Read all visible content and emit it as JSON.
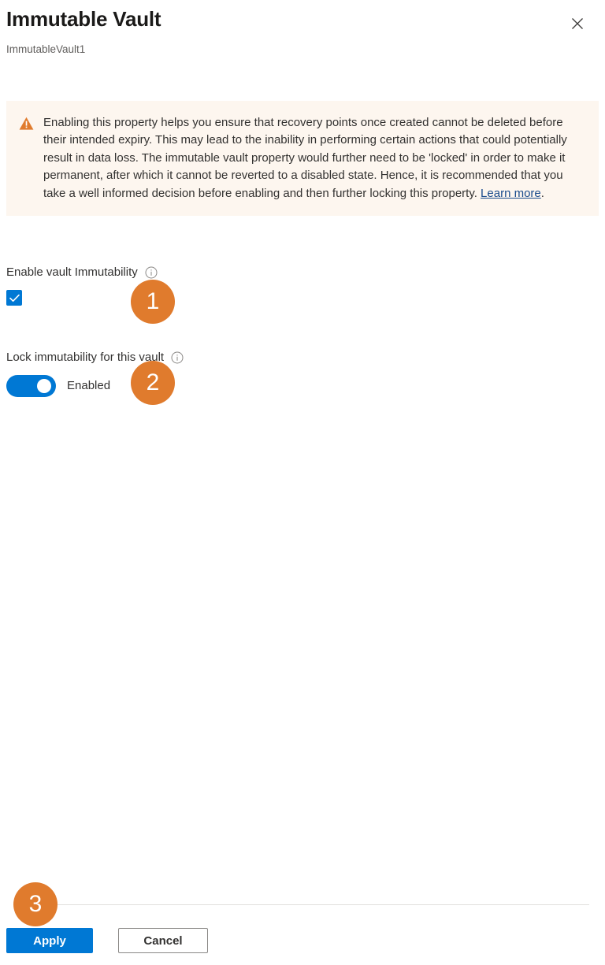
{
  "header": {
    "title": "Immutable Vault",
    "subtitle": "ImmutableVault1",
    "close_icon": "close-icon",
    "close_label": "Close"
  },
  "warning": {
    "icon": "warning-triangle-icon",
    "text": "Enabling this property helps you ensure that recovery points once created cannot be deleted before their intended expiry. This may lead to the inability in performing certain actions that could potentially result in data loss. The immutable vault property would further need to be 'locked' in order to make it permanent, after which it cannot be reverted to a disabled state. Hence, it is recommended that you take a well informed decision before enabling and then further locking this property. ",
    "link_text": "Learn more",
    "text_after_link": ".",
    "background_color": "#fdf6ef",
    "icon_color": "#e07b2d"
  },
  "form": {
    "enable_immutability": {
      "label": "Enable vault Immutability",
      "info_icon": "info-icon",
      "checked": true,
      "checkbox_color": "#0078d4"
    },
    "lock_immutability": {
      "label": "Lock immutability for this vault",
      "info_icon": "info-icon",
      "toggle_on": true,
      "state_label": "Enabled",
      "toggle_color": "#0078d4"
    }
  },
  "footer": {
    "apply_label": "Apply",
    "cancel_label": "Cancel",
    "primary_color": "#0078d4"
  },
  "annotations": {
    "badge_color": "#e07b2d",
    "items": [
      {
        "number": "1"
      },
      {
        "number": "2"
      },
      {
        "number": "3"
      }
    ]
  }
}
